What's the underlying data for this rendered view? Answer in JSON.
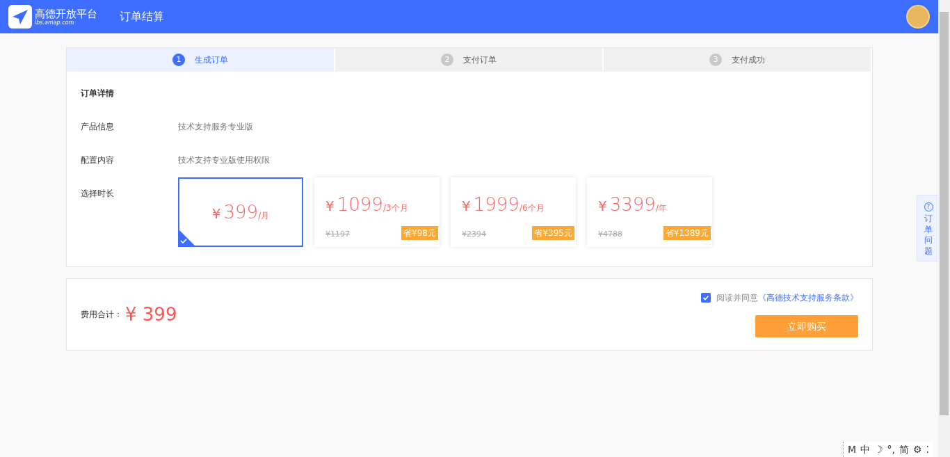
{
  "header": {
    "logo_title": "高德开放平台",
    "logo_subtitle": "lbs.amap.com",
    "page_title": "订单结算"
  },
  "steps": [
    {
      "number": "1",
      "label": "生成订单",
      "selected": true
    },
    {
      "number": "2",
      "label": "支付订单",
      "selected": false
    },
    {
      "number": "3",
      "label": "支付成功",
      "selected": false
    }
  ],
  "order_details": {
    "title": "订单详情",
    "fields": [
      {
        "label": "产品信息",
        "value": "技术支持服务专业版"
      },
      {
        "label": "配置内容",
        "value": "技术支持专业版使用权限"
      }
    ],
    "duration_label": "选择时长",
    "plans": [
      {
        "currency": "¥",
        "price": "399",
        "unit": "/月",
        "selected": true
      },
      {
        "currency": "¥",
        "price": "1099",
        "unit": "/3个月",
        "original": "¥1197",
        "saving": "省¥98元",
        "selected": false
      },
      {
        "currency": "¥",
        "price": "1999",
        "unit": "/6个月",
        "original": "¥2394",
        "saving": "省¥395元",
        "selected": false
      },
      {
        "currency": "¥",
        "price": "3399",
        "unit": "/年",
        "original": "¥4788",
        "saving": "省¥1389元",
        "selected": false
      }
    ]
  },
  "summary": {
    "total_label": "费用合计：",
    "currency": "¥",
    "total": "399",
    "agree_checked": true,
    "agree_text": "阅读并同意",
    "terms_link": "《高德技术支持服务条款》",
    "buy_button": "立即购买"
  },
  "help_tab": {
    "icon": "?",
    "label": "订单问题"
  },
  "ime_toolbar": [
    "M",
    "中",
    "☽",
    "°,",
    "简",
    "⚙",
    "⁚"
  ]
}
